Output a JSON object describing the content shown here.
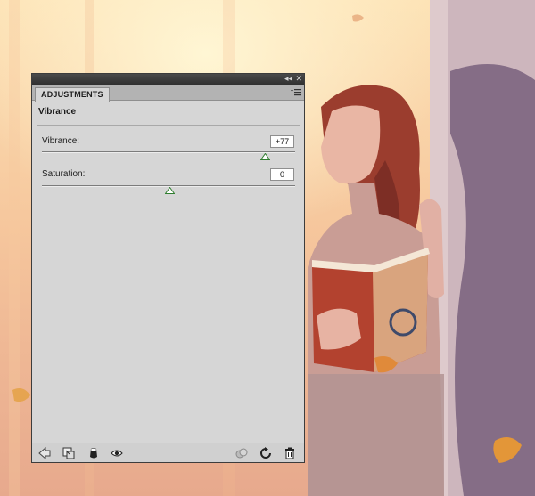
{
  "panel": {
    "tab_label": "ADJUSTMENTS",
    "adjustment_title": "Vibrance",
    "sliders": [
      {
        "label": "Vibrance:",
        "value": "+77",
        "level": 0.885
      },
      {
        "label": "Saturation:",
        "value": "0",
        "level": 0.5
      }
    ]
  },
  "titlebar": {
    "collapse_glyph": "◂◂",
    "close_glyph": "✕"
  },
  "icons": [
    "return-arrow-icon",
    "clip-to-layer-icon",
    "layer-visibility-toggle-icon",
    "eye-icon",
    "previous-state-icon",
    "reset-icon",
    "trash-icon"
  ],
  "colors": {
    "panel_bg": "#d6d6d6",
    "titlebar": "#3a3a3a",
    "thumb_green": "#3d8b3d"
  }
}
